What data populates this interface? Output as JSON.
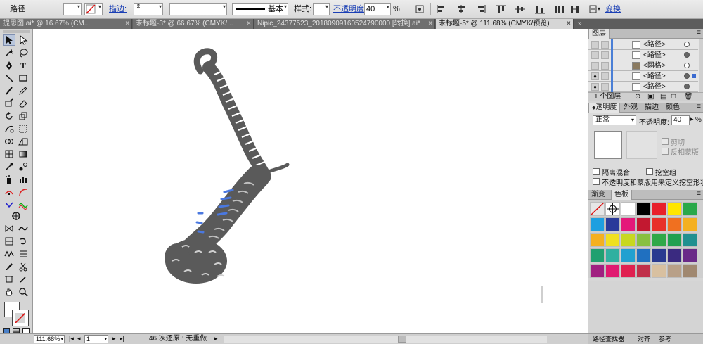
{
  "control_bar": {
    "selection_label": "路径",
    "stroke_label": "描边:",
    "stroke_style_label": "基本",
    "style_label": "样式:",
    "opacity_label": "不透明度:",
    "opacity_value": "40",
    "opacity_unit": "%",
    "transform_label": "变换"
  },
  "tabs": [
    {
      "label": "提思图.ai* @ 16.67% (CM...",
      "close": "×",
      "active": false
    },
    {
      "label": "未标题-3* @ 66.67% (CMYK/...",
      "close": "×",
      "active": false
    },
    {
      "label": "Nipic_24377523_20180909160524790000 [转换].ai*",
      "close": "×",
      "active": false
    },
    {
      "label": "未标题-5* @ 111.68% (CMYK/预览)",
      "close": "×",
      "active": true
    }
  ],
  "tabs_overflow": "»",
  "status": {
    "zoom": "111.68%",
    "page": "1",
    "history": "46 次还原 : 无重做"
  },
  "layers_panel": {
    "title": "图层",
    "rows": [
      {
        "name": "<路径>",
        "target": "empty"
      },
      {
        "name": "<路径>",
        "target": "filled"
      },
      {
        "name": "<网格>",
        "target": "empty"
      },
      {
        "name": "<路径>",
        "target": "filled"
      },
      {
        "name": "<路径>",
        "target": "filled"
      }
    ],
    "footer": "1 个图层"
  },
  "transparency_panel": {
    "tabs": [
      "透明度",
      "外观",
      "描边",
      "颜色"
    ],
    "blend_mode": "正常",
    "opacity_label": "不透明度:",
    "opacity_value": "40",
    "clip_label": "剪切",
    "invert_label": "反相蒙版",
    "isolate_label": "隔离混合",
    "knockout_label": "挖空组",
    "knockout_mask_label": "不透明度和蒙版用来定义挖空形状"
  },
  "swatches_panel": {
    "tabs": [
      "渐变",
      "色板"
    ],
    "colors": [
      "#e6e6e6",
      "#ffffff",
      "#ffffff",
      "#000000",
      "#e8202a",
      "#ffe600",
      "#2aa84a",
      "#1e9fe0",
      "#2a3a9a",
      "#e4197a",
      "#c21830",
      "#e8302a",
      "#f07020",
      "#f4b020",
      "#f4b020",
      "#f0e020",
      "#c8d820",
      "#88c040",
      "#30a848",
      "#20a050",
      "#209090",
      "#20a070",
      "#30b0a0",
      "#20a0d0",
      "#2070c0",
      "#2a3a90",
      "#3a2a80",
      "#6a2a88",
      "#a02080",
      "#e01a70",
      "#e02050",
      "#c0304a",
      "#d8c0a0",
      "#b8a088",
      "#a08870"
    ]
  },
  "bottom_right_labels": {
    "path_finder": "路径查找器",
    "align": "对齐",
    "more": "参考"
  }
}
